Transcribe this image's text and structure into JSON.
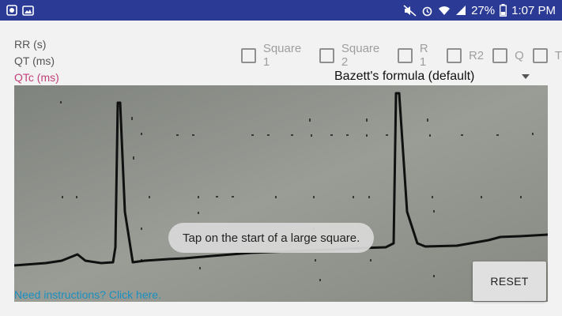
{
  "status_bar": {
    "battery": "27%",
    "time": "1:07 PM"
  },
  "labels": {
    "rr": "RR (s)",
    "qt": "QT (ms)",
    "qtc": "QTc (ms)"
  },
  "checkboxes": [
    {
      "label": "Square 1",
      "checked": false
    },
    {
      "label": "Square 2",
      "checked": false
    },
    {
      "label": "R 1",
      "checked": false
    },
    {
      "label": "R2",
      "checked": false
    },
    {
      "label": "Q",
      "checked": false
    },
    {
      "label": "T",
      "checked": false
    }
  ],
  "formula": {
    "selected": "Bazett's formula (default)"
  },
  "toast": {
    "text": "Tap on the start of a large square."
  },
  "reset_label": "RESET",
  "help_link": "Need instructions? Click here.",
  "colors": {
    "status_bar": "#2a3a95",
    "qtc_label": "#c2407a",
    "link": "#1a8fc0"
  }
}
